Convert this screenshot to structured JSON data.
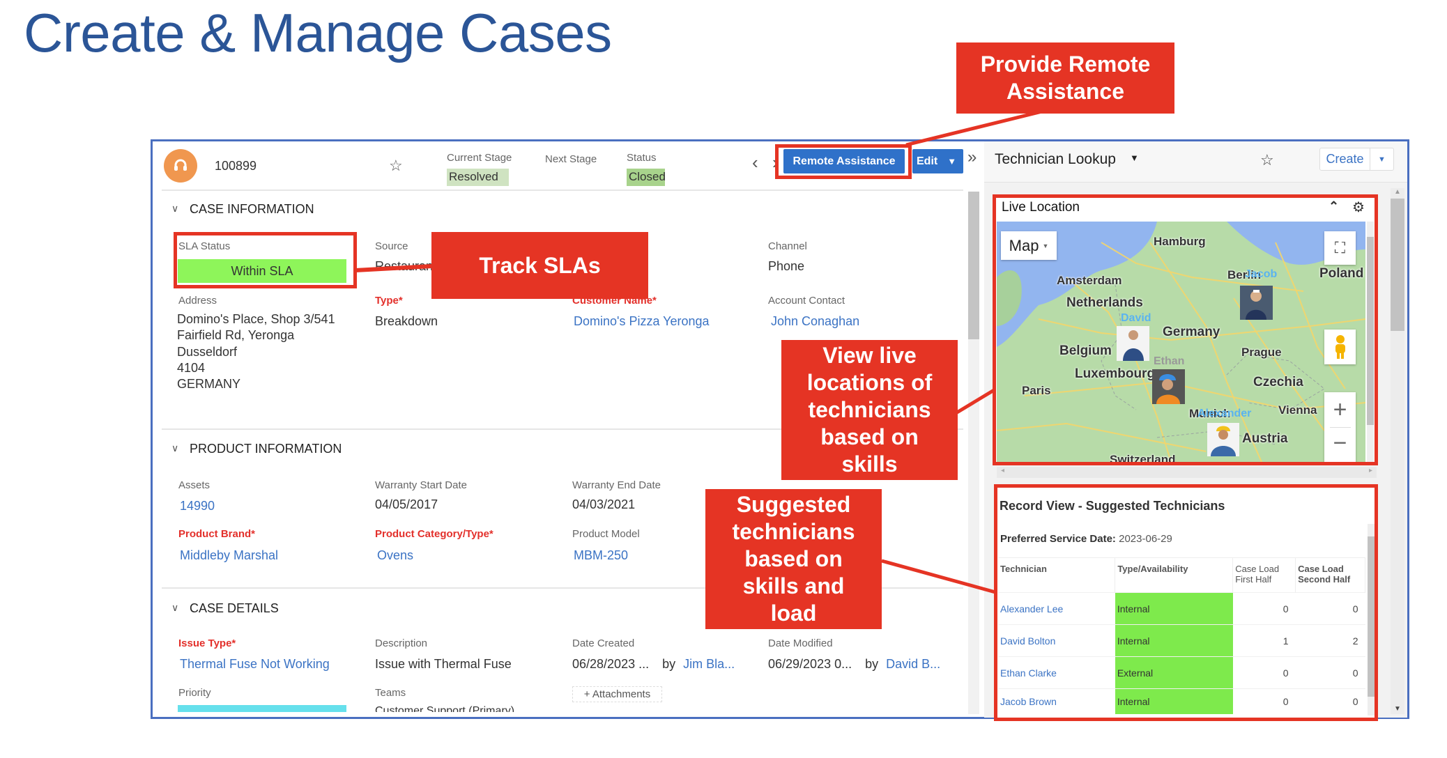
{
  "title": "Create & Manage Cases",
  "callouts": {
    "remote": "Provide Remote Assistance",
    "sla": "Track SLAs",
    "live": "View live locations of technicians based on skills",
    "suggested": "Suggested technicians based on skills and load"
  },
  "colors": {
    "accent": "#2f71c9",
    "callout": "#e53424",
    "sla_ok": "#8ef55a",
    "availability": "#7eea4c",
    "priority": "#66e0ec"
  },
  "case": {
    "number": "100899",
    "current_stage_label": "Current Stage",
    "current_stage": "Resolved",
    "next_stage_label": "Next Stage",
    "status_label": "Status",
    "status": "Closed",
    "remote_assistance": "Remote Assistance",
    "edit": "Edit",
    "prev": "‹",
    "next": "›",
    "expand": "»"
  },
  "case_information": {
    "heading": "CASE INFORMATION",
    "sla_label": "SLA Status",
    "sla_value": "Within SLA",
    "source_label": "Source",
    "source_value": "Restaurant",
    "channel_label": "Channel",
    "channel_value": "Phone",
    "address_label": "Address",
    "address_lines": [
      "Domino's Place, Shop 3/541",
      "Fairfield Rd, Yeronga",
      "Dusseldorf",
      "4104",
      "GERMANY"
    ],
    "type_label": "Type*",
    "type_value": "Breakdown",
    "customer_label": "Customer Name*",
    "customer_value": "Domino's Pizza Yeronga",
    "contact_label": "Account Contact",
    "contact_value": "John Conaghan"
  },
  "product_information": {
    "heading": "PRODUCT INFORMATION",
    "assets_label": "Assets",
    "assets_value": "14990",
    "wstart_label": "Warranty Start Date",
    "wstart_value": "04/05/2017",
    "wend_label": "Warranty End Date",
    "wend_value": "04/03/2021",
    "brand_label": "Product Brand*",
    "brand_value": "Middleby Marshal",
    "category_label": "Product Category/Type*",
    "category_value": "Ovens",
    "model_label": "Product Model",
    "model_value": "MBM-250"
  },
  "case_details": {
    "heading": "CASE DETAILS",
    "issue_label": "Issue Type*",
    "issue_value": "Thermal Fuse Not Working",
    "desc_label": "Description",
    "desc_value": "Issue with Thermal Fuse",
    "created_label": "Date Created",
    "created_value": "06/28/2023 ...",
    "created_by": "by",
    "created_user": "Jim Bla...",
    "modified_label": "Date Modified",
    "modified_value": "06/29/2023 0...",
    "modified_by": "by",
    "modified_user": "David B...",
    "priority_label": "Priority",
    "teams_label": "Teams",
    "teams_value": "Customer Support (Primary)",
    "attachments": "+ Attachments"
  },
  "technician_lookup": {
    "title": "Technician Lookup",
    "create": "Create",
    "live_location": {
      "title": "Live Location",
      "map_type": "Map",
      "places": [
        "Hamburg",
        "Amsterdam",
        "Netherlands",
        "Berlin",
        "Poland",
        "Germany",
        "Belgium",
        "Prague",
        "Luxembourg",
        "Czechia",
        "Paris",
        "Vienna",
        "Munich",
        "Austria",
        "Switzerland"
      ],
      "technicians": [
        "Jacob",
        "David",
        "Ethan",
        "Alexander"
      ]
    },
    "suggested": {
      "title": "Record View - Suggested Technicians",
      "pref_label": "Preferred Service Date:",
      "pref_value": "2023-06-29",
      "columns": [
        "Technician",
        "Type/Availability",
        "Case Load First Half",
        "Case Load Second Half"
      ],
      "rows": [
        {
          "name": "Alexander Lee",
          "type": "Internal",
          "first": "0",
          "second": "0"
        },
        {
          "name": "David Bolton",
          "type": "Internal",
          "first": "1",
          "second": "2"
        },
        {
          "name": "Ethan Clarke",
          "type": "External",
          "first": "0",
          "second": "0"
        },
        {
          "name": "Jacob Brown",
          "type": "Internal",
          "first": "0",
          "second": "0"
        }
      ]
    }
  }
}
